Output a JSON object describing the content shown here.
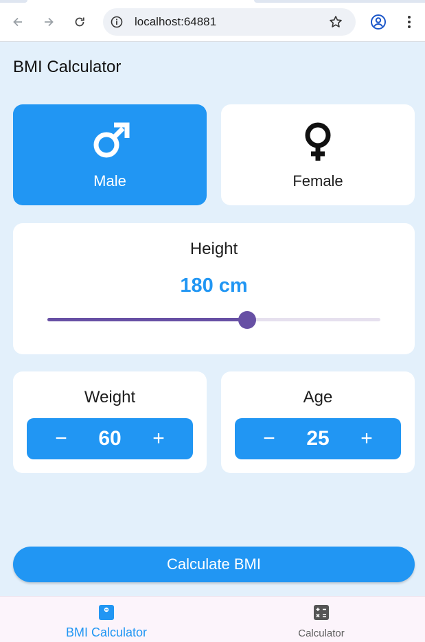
{
  "browser": {
    "url": "localhost:64881"
  },
  "app": {
    "title": "BMI Calculator",
    "accent_color": "#2196f3",
    "slider_color": "#6750a4"
  },
  "gender": {
    "options": [
      {
        "label": "Male",
        "icon": "male-icon",
        "selected": true
      },
      {
        "label": "Female",
        "icon": "female-icon",
        "selected": false
      }
    ]
  },
  "height": {
    "title": "Height",
    "value_text": "180 cm",
    "slider_fraction": 0.6
  },
  "weight": {
    "title": "Weight",
    "value": "60",
    "minus_label": "−",
    "plus_label": "+"
  },
  "age": {
    "title": "Age",
    "value": "25",
    "minus_label": "−",
    "plus_label": "+"
  },
  "calculate_label": "Calculate BMI",
  "bottom_nav": {
    "items": [
      {
        "label": "BMI Calculator",
        "icon": "bmi-icon",
        "active": true
      },
      {
        "label": "Calculator",
        "icon": "calculator-icon",
        "active": false
      }
    ]
  }
}
